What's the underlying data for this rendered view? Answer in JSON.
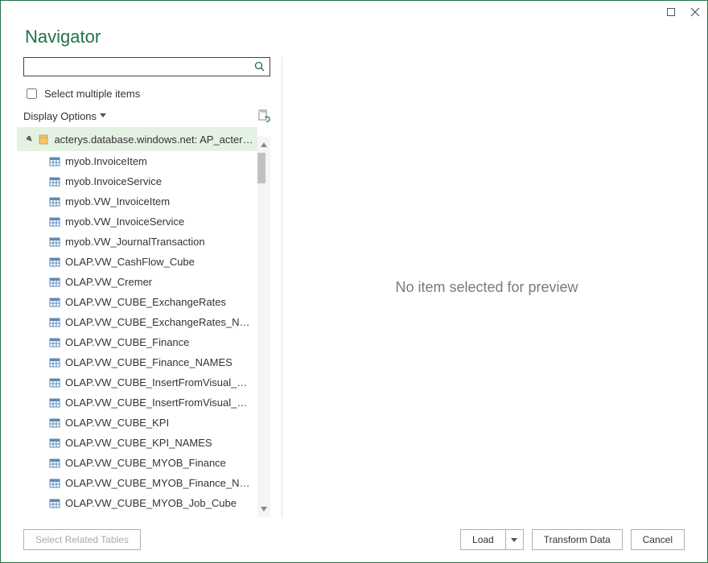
{
  "title": "Navigator",
  "search": {
    "placeholder": ""
  },
  "selectMultiple": {
    "label": "Select multiple items",
    "checked": false
  },
  "displayOptions": {
    "label": "Display Options"
  },
  "tree": {
    "root": {
      "label": "acterys.database.windows.net: AP_acterysd..."
    },
    "items": [
      {
        "label": "myob.InvoiceItem"
      },
      {
        "label": "myob.InvoiceService"
      },
      {
        "label": "myob.VW_InvoiceItem"
      },
      {
        "label": "myob.VW_InvoiceService"
      },
      {
        "label": "myob.VW_JournalTransaction"
      },
      {
        "label": "OLAP.VW_CashFlow_Cube"
      },
      {
        "label": "OLAP.VW_Cremer"
      },
      {
        "label": "OLAP.VW_CUBE_ExchangeRates"
      },
      {
        "label": "OLAP.VW_CUBE_ExchangeRates_NAMES"
      },
      {
        "label": "OLAP.VW_CUBE_Finance"
      },
      {
        "label": "OLAP.VW_CUBE_Finance_NAMES"
      },
      {
        "label": "OLAP.VW_CUBE_InsertFromVisual_Cube"
      },
      {
        "label": "OLAP.VW_CUBE_InsertFromVisual_Cube_..."
      },
      {
        "label": "OLAP.VW_CUBE_KPI"
      },
      {
        "label": "OLAP.VW_CUBE_KPI_NAMES"
      },
      {
        "label": "OLAP.VW_CUBE_MYOB_Finance"
      },
      {
        "label": "OLAP.VW_CUBE_MYOB_Finance_NAMES"
      },
      {
        "label": "OLAP.VW_CUBE_MYOB_Job_Cube"
      }
    ]
  },
  "preview": {
    "message": "No item selected for preview"
  },
  "footer": {
    "selectRelated": "Select Related Tables",
    "load": "Load",
    "transform": "Transform Data",
    "cancel": "Cancel"
  }
}
